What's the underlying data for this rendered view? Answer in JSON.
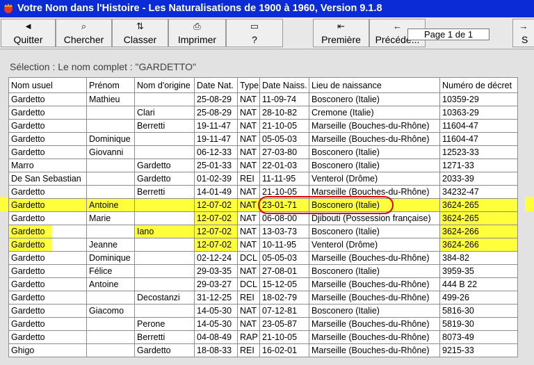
{
  "window": {
    "title": "Votre Nom dans l'Histoire - Les Naturalisations de 1900 à 1960, Version 9.1.8"
  },
  "toolbar": {
    "buttons": [
      {
        "name": "quit-button",
        "icon": "back-arrow-icon",
        "glyph": "◄",
        "label": "Quitter"
      },
      {
        "name": "search-button",
        "icon": "binoculars-icon",
        "glyph": "⌕",
        "label": "Chercher"
      },
      {
        "name": "sort-button",
        "icon": "sort-icon",
        "glyph": "⇅",
        "label": "Classer"
      },
      {
        "name": "print-button",
        "icon": "printer-icon",
        "glyph": "⎙",
        "label": "Imprimer"
      },
      {
        "name": "help-button",
        "icon": "book-icon",
        "glyph": "▭",
        "label": "?"
      },
      {
        "name": "first-page-button",
        "icon": "first-page-icon",
        "glyph": "⇤",
        "label": "Première"
      },
      {
        "name": "previous-page-button",
        "icon": "previous-icon",
        "glyph": "←",
        "label": "Précéde..."
      },
      {
        "name": "next-page-button",
        "icon": "next-icon",
        "glyph": "→",
        "label": "S"
      }
    ],
    "page_indicator": "Page 1 de 1"
  },
  "selection_label": "Sélection : Le nom complet : \"GARDETTO\"",
  "table": {
    "columns": [
      "Nom usuel",
      "Prénom",
      "Nom d'origine",
      "Date Nat.",
      "Type",
      "Date Naiss.",
      "Lieu de naissance",
      "Numéro de décret"
    ],
    "rows": [
      [
        "Gardetto",
        "Mathieu",
        "",
        "25-08-29",
        "NAT",
        "11-09-74",
        "Bosconero (Italie)",
        "10359-29"
      ],
      [
        "Gardetto",
        "",
        "Clari",
        "25-08-29",
        "NAT",
        "28-10-82",
        "Cremone (Italie)",
        "10363-29"
      ],
      [
        "Gardetto",
        "",
        "Berretti",
        "19-11-47",
        "NAT",
        "21-10-05",
        "Marseille (Bouches-du-Rhône)",
        "11604-47"
      ],
      [
        "Gardetto",
        "Dominique",
        "",
        "19-11-47",
        "NAT",
        "05-05-03",
        "Marseille (Bouches-du-Rhône)",
        "11604-47"
      ],
      [
        "Gardetto",
        "Giovanni",
        "",
        "06-12-33",
        "NAT",
        "27-03-80",
        "Bosconero (Italie)",
        "12523-33"
      ],
      [
        "Marro",
        "",
        "Gardetto",
        "25-01-33",
        "NAT",
        "22-01-03",
        "Bosconero (Italie)",
        "1271-33"
      ],
      [
        "De San Sebastian",
        "",
        "Gardetto",
        "01-02-39",
        "REI",
        "11-11-95",
        "Venterol (Drôme)",
        "2033-39"
      ],
      [
        "Gardetto",
        "",
        "Berretti",
        "14-01-49",
        "NAT",
        "21-10-05",
        "Marseille (Bouches-du-Rhône)",
        "34232-47"
      ],
      [
        "Gardetto",
        "Antoine",
        "",
        "12-07-02",
        "NAT",
        "23-01-71",
        "Bosconero (Italie)",
        "3624-265"
      ],
      [
        "Gardetto",
        "Marie",
        "",
        "12-07-02",
        "NAT",
        "06-08-00",
        "Djibouti (Possession française)",
        "3624-265"
      ],
      [
        "Gardetto",
        "",
        "Iano",
        "12-07-02",
        "NAT",
        "13-03-73",
        "Bosconero (Italie)",
        "3624-266"
      ],
      [
        "Gardetto",
        "Jeanne",
        "",
        "12-07-02",
        "NAT",
        "10-11-95",
        "Venterol (Drôme)",
        "3624-266"
      ],
      [
        "Gardetto",
        "Dominique",
        "",
        "02-12-24",
        "DCL",
        "05-05-03",
        "Marseille (Bouches-du-Rhône)",
        "384-82"
      ],
      [
        "Gardetto",
        "Félice",
        "",
        "29-03-35",
        "NAT",
        "27-08-01",
        "Bosconero (Italie)",
        "3959-35"
      ],
      [
        "Gardetto",
        "Antoine",
        "",
        "29-03-27",
        "DCL",
        "15-12-05",
        "Marseille (Bouches-du-Rhône)",
        "444 B 22"
      ],
      [
        "Gardetto",
        "",
        "Decostanzi",
        "31-12-25",
        "REI",
        "18-02-79",
        "Marseille (Bouches-du-Rhône)",
        "499-26"
      ],
      [
        "Gardetto",
        "Giacomo",
        "",
        "14-05-30",
        "NAT",
        "07-12-81",
        "Bosconero (Italie)",
        "5816-30"
      ],
      [
        "Gardetto",
        "",
        "Perone",
        "14-05-30",
        "NAT",
        "23-05-87",
        "Marseille (Bouches-du-Rhône)",
        "5819-30"
      ],
      [
        "Gardetto",
        "",
        "Berretti",
        "04-08-49",
        "RAP",
        "21-10-05",
        "Marseille (Bouches-du-Rhône)",
        "8073-49"
      ],
      [
        "Ghigo",
        "",
        "Gardetto",
        "18-08-33",
        "REI",
        "16-02-01",
        "Marseille (Bouches-du-Rhône)",
        "9215-33"
      ]
    ]
  },
  "highlight_color": "#ffff3c",
  "annotation_color": "#e00000"
}
